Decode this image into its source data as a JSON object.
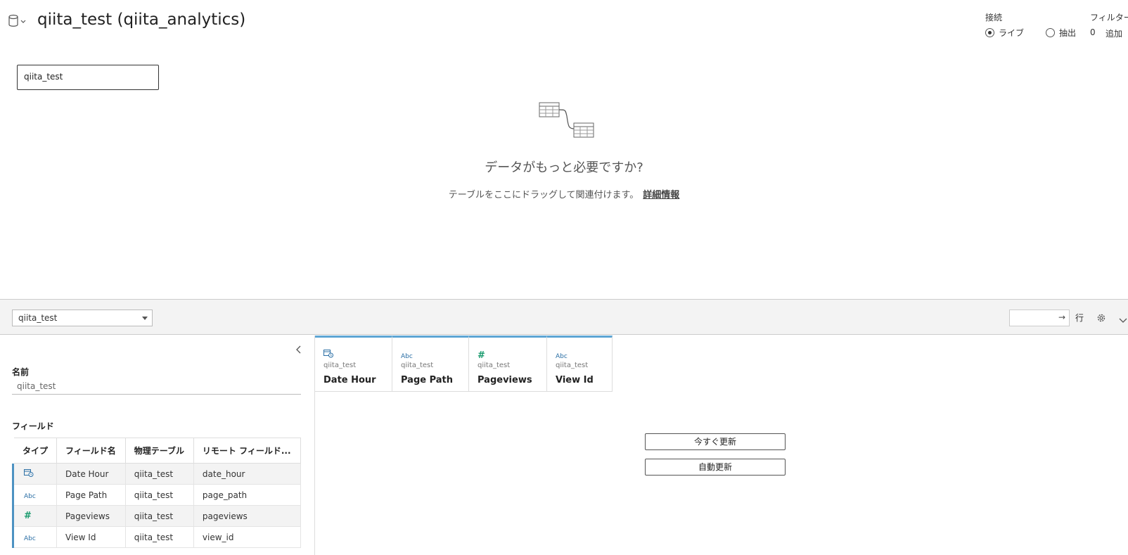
{
  "header": {
    "title": "qiita_test (qiita_analytics)",
    "connection": {
      "label": "接続",
      "live_label": "ライブ",
      "extract_label": "抽出",
      "selected": "live"
    },
    "filters": {
      "label": "フィルター",
      "count": "0",
      "add_label": "追加"
    }
  },
  "canvas": {
    "table_chip": "qiita_test",
    "empty_title": "データがもっと必要ですか?",
    "empty_desc": "テーブルをここにドラッグして関連付けます。",
    "learn_more": "詳細情報"
  },
  "toolbar": {
    "table_select": "qiita_test",
    "rows_label": "行"
  },
  "metadata": {
    "name_label": "名前",
    "name_value": "qiita_test",
    "fields_label": "フィールド",
    "columns": [
      "タイプ",
      "フィールド名",
      "物理テーブル",
      "リモート フィールド..."
    ],
    "rows": [
      {
        "type": "datetime",
        "type_label": "",
        "name": "Date Hour",
        "table": "qiita_test",
        "remote": "date_hour"
      },
      {
        "type": "string",
        "type_label": "Abc",
        "name": "Page Path",
        "table": "qiita_test",
        "remote": "page_path"
      },
      {
        "type": "number",
        "type_label": "#",
        "name": "Pageviews",
        "table": "qiita_test",
        "remote": "pageviews"
      },
      {
        "type": "string",
        "type_label": "Abc",
        "name": "View Id",
        "table": "qiita_test",
        "remote": "view_id"
      }
    ]
  },
  "grid": {
    "columns": [
      {
        "type": "datetime",
        "type_label": "",
        "table": "qiita_test",
        "name": "Date Hour"
      },
      {
        "type": "string",
        "type_label": "Abc",
        "table": "qiita_test",
        "name": "Page Path"
      },
      {
        "type": "number",
        "type_label": "#",
        "table": "qiita_test",
        "name": "Pageviews"
      },
      {
        "type": "string",
        "type_label": "Abc",
        "table": "qiita_test",
        "name": "View Id"
      }
    ],
    "update_now_label": "今すぐ更新",
    "auto_update_label": "自動更新"
  },
  "colors": {
    "accent_blue": "#5da5d4",
    "number_green": "#1a9b6e",
    "string_blue": "#2b6fa5"
  }
}
